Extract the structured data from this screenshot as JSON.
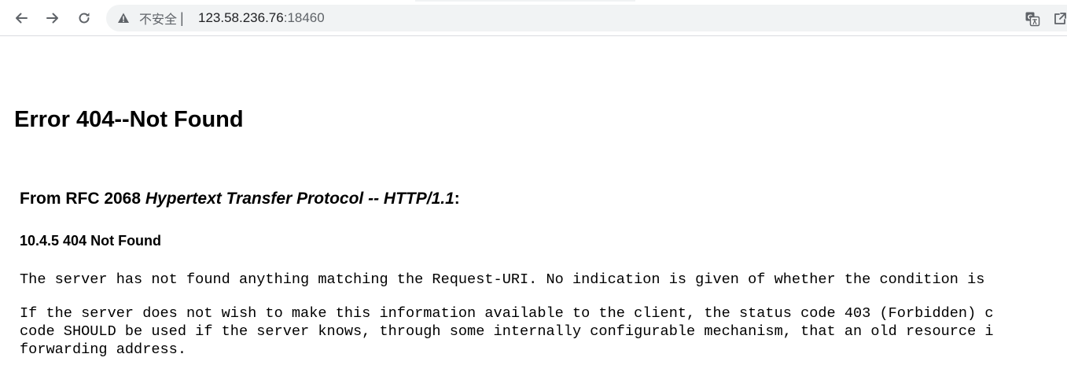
{
  "browser": {
    "security_label": "不安全",
    "separator": "|",
    "url_host": "123.58.236.76",
    "url_port": ":18460",
    "icons": {
      "back": "back-arrow-icon",
      "forward": "forward-arrow-icon",
      "reload": "reload-icon",
      "security": "warning-triangle-icon",
      "translate": "translate-icon",
      "share": "share-icon"
    }
  },
  "page": {
    "title": "Error 404--Not Found",
    "rfc_prefix": "From RFC 2068 ",
    "rfc_title": "Hypertext Transfer Protocol -- HTTP/1.1",
    "rfc_suffix": ":",
    "section_heading": "10.4.5 404 Not Found",
    "paragraph1": "The server has not found anything matching the Request-URI. No indication is given of whether the condition is",
    "paragraph2": "If the server does not wish to make this information available to the client, the status code 403 (Forbidden) c\ncode SHOULD be used if the server knows, through some internally configurable mechanism, that an old resource i\nforwarding address."
  }
}
